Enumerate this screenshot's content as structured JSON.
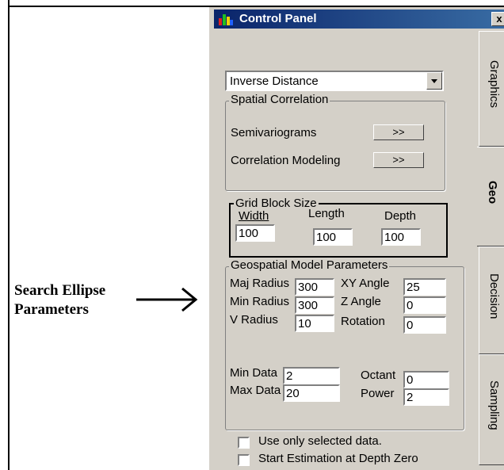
{
  "annotation": {
    "line1": "Search Ellipse",
    "line2": "Parameters"
  },
  "window": {
    "title": "Control Panel",
    "close": "x"
  },
  "method": {
    "selected": "Inverse Distance"
  },
  "spatial_correlation": {
    "legend": "Spatial Correlation",
    "semivariograms_label": "Semivariograms",
    "semivariograms_button": ">>",
    "modeling_label": "Correlation Modeling",
    "modeling_button": ">>"
  },
  "grid_block": {
    "legend": "Grid Block Size",
    "width_label": "Width",
    "width_value": "100",
    "length_label": "Length",
    "length_value": "100",
    "depth_label": "Depth",
    "depth_value": "100"
  },
  "geospatial": {
    "legend": "Geospatial Model Parameters",
    "maj_radius_label": "Maj Radius",
    "maj_radius_value": "300",
    "xy_angle_label": "XY Angle",
    "xy_angle_value": "25",
    "min_radius_label": "Min Radius",
    "min_radius_value": "300",
    "z_angle_label": "Z Angle",
    "z_angle_value": "0",
    "v_radius_label": "V Radius",
    "v_radius_value": "10",
    "rotation_label": "Rotation",
    "rotation_value": "0",
    "min_data_label": "Min Data",
    "min_data_value": "2",
    "octant_label": "Octant",
    "octant_value": "0",
    "max_data_label": "Max Data",
    "max_data_value": "20",
    "power_label": "Power",
    "power_value": "2"
  },
  "options": {
    "selected_only_label": "Use only selected data.",
    "depth_zero_label": "Start Estimation at Depth Zero"
  },
  "tabs": [
    {
      "label": "Graphics"
    },
    {
      "label": "Geo"
    },
    {
      "label": "Decision"
    },
    {
      "label": "Sampling"
    }
  ]
}
